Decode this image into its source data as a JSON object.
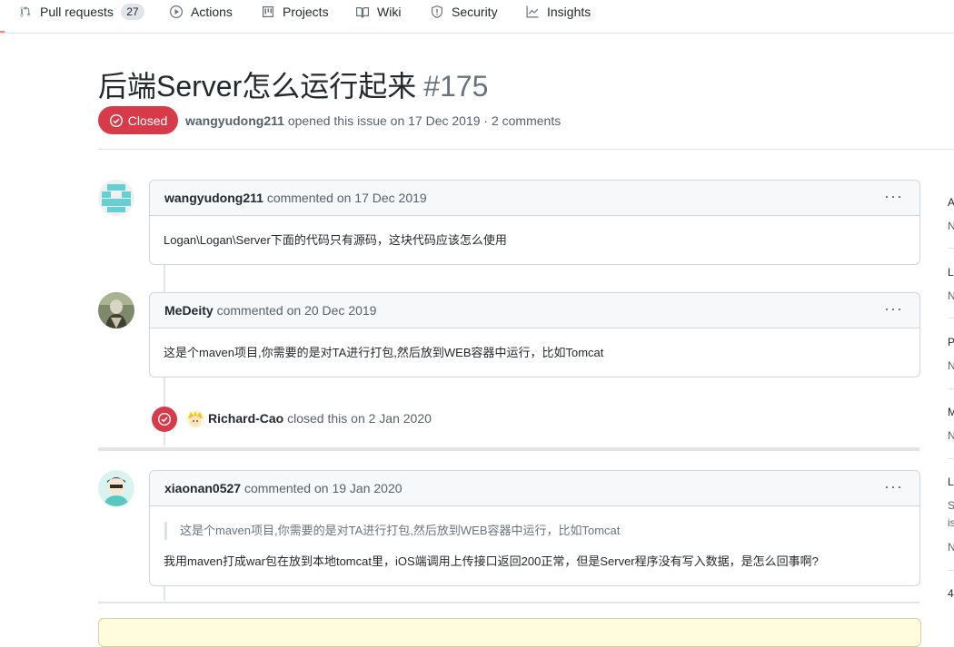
{
  "nav": {
    "tabs": [
      {
        "label": "Pull requests",
        "count": "27",
        "icon": "git-pull-request-icon"
      },
      {
        "label": "Actions",
        "icon": "play-icon"
      },
      {
        "label": "Projects",
        "icon": "project-icon"
      },
      {
        "label": "Wiki",
        "icon": "book-icon"
      },
      {
        "label": "Security",
        "icon": "shield-icon"
      },
      {
        "label": "Insights",
        "icon": "graph-icon"
      }
    ]
  },
  "issue": {
    "title": "后端Server怎么运行起来",
    "number": "#175",
    "state": "Closed",
    "state_color": "#d73a49",
    "author": "wangyudong211",
    "opened_text": "opened this issue on 17 Dec 2019 · 2 comments"
  },
  "comments": [
    {
      "author": "wangyudong211",
      "meta": "commented on 17 Dec 2019",
      "body": "Logan\\Logan\\Server下面的代码只有源码，这块代码应该怎么使用"
    },
    {
      "author": "MeDeity",
      "meta": "commented on 20 Dec 2019",
      "body": "这是个maven项目,你需要的是对TA进行打包,然后放到WEB容器中运行，比如Tomcat"
    },
    {
      "author": "xiaonan0527",
      "meta": "commented on 19 Jan 2020",
      "quote": "这是个maven项目,你需要的是对TA进行打包,然后放到WEB容器中运行，比如Tomcat",
      "body": "我用maven打成war包在放到本地tomcat里，iOS端调用上传接口返回200正常，但是Server程序没有写入数据，是怎么回事啊?"
    }
  ],
  "event": {
    "actor": "Richard-Cao",
    "text": "closed this on 2 Jan 2020"
  },
  "kebab": "···",
  "sidebar": {
    "letters": [
      "A",
      "L",
      "P",
      "M",
      "L",
      "4"
    ],
    "subs": [
      "N",
      "N",
      "N",
      "N",
      "S",
      "is",
      "N"
    ]
  }
}
